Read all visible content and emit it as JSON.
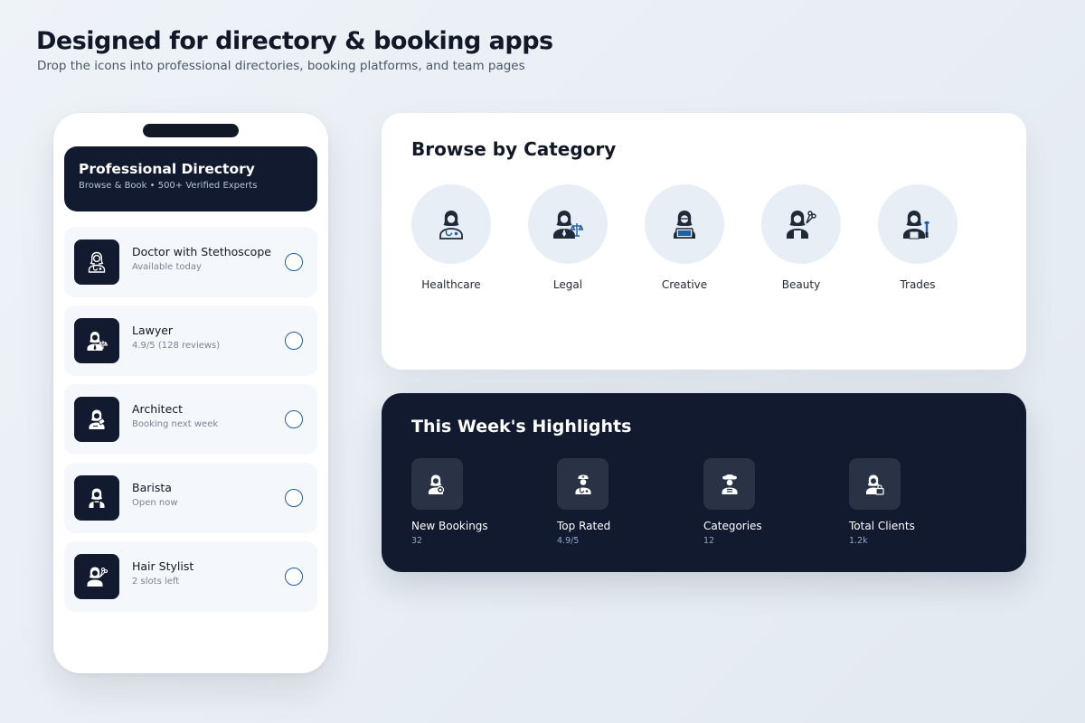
{
  "hero": {
    "title": "Designed for directory & booking apps",
    "subtitle": "Drop the icons into professional directories, booking platforms, and team pages"
  },
  "directory": {
    "title": "Professional Directory",
    "subtitle": "Browse & Book • 500+ Verified Experts",
    "items": [
      {
        "name": "Doctor with Stethoscope",
        "meta": "Available today",
        "icon": "doctor-icon"
      },
      {
        "name": "Lawyer",
        "meta": "4.9/5 (128 reviews)",
        "icon": "lawyer-icon"
      },
      {
        "name": "Architect",
        "meta": "Booking next week",
        "icon": "architect-icon"
      },
      {
        "name": "Barista",
        "meta": "Open now",
        "icon": "barista-icon"
      },
      {
        "name": "Hair Stylist",
        "meta": "2 slots left",
        "icon": "hair-stylist-icon"
      }
    ]
  },
  "categories": {
    "title": "Browse by Category",
    "items": [
      {
        "label": "Healthcare",
        "icon": "healthcare-icon"
      },
      {
        "label": "Legal",
        "icon": "legal-icon"
      },
      {
        "label": "Creative",
        "icon": "creative-icon"
      },
      {
        "label": "Beauty",
        "icon": "beauty-icon"
      },
      {
        "label": "Trades",
        "icon": "trades-icon"
      }
    ]
  },
  "highlights": {
    "title": "This Week's Highlights",
    "items": [
      {
        "label": "New Bookings",
        "value": "32",
        "icon": "new-bookings-icon"
      },
      {
        "label": "Top Rated",
        "value": "4.9/5",
        "icon": "top-rated-icon"
      },
      {
        "label": "Categories",
        "value": "12",
        "icon": "categories-icon"
      },
      {
        "label": "Total Clients",
        "value": "1.2k",
        "icon": "total-clients-icon"
      }
    ]
  },
  "colors": {
    "navy": "#111a2e",
    "accent_blue": "#1d5fa8",
    "card_bg": "#ffffff",
    "soft_bg": "#f4f7fb"
  }
}
